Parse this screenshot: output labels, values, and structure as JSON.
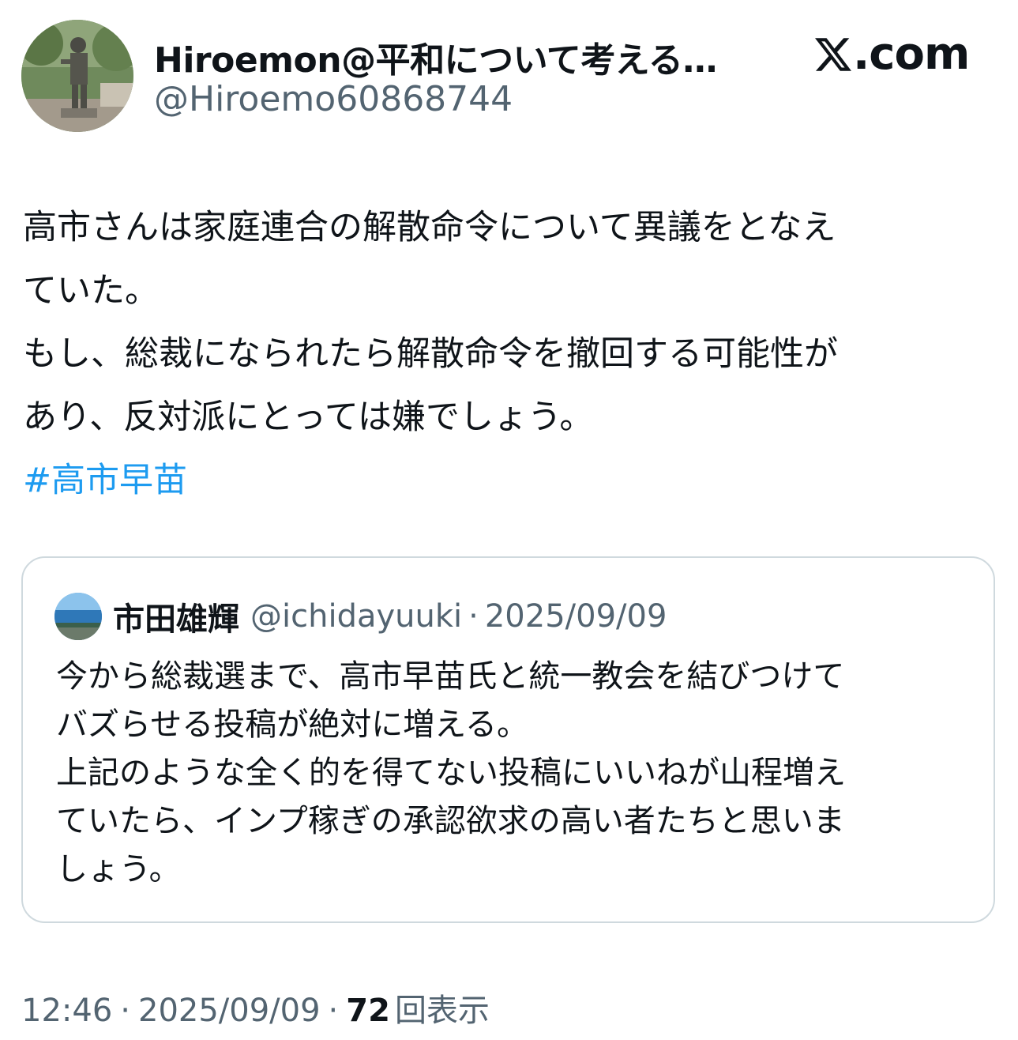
{
  "author": {
    "display_name": "Hiroemon@平和について考える…",
    "handle": "@Hiroemo60868744"
  },
  "brand": {
    "logo_suffix": ".com",
    "icon": "x-logo-icon"
  },
  "tweet": {
    "lines": [
      "高市さんは家庭連合の解散命令について異議をとなえ",
      "ていた。",
      "もし、総裁になられたら解散命令を撤回する可能性が",
      "あり、反対派にとっては嫌でしょう。"
    ],
    "hashtag": "#高市早苗"
  },
  "quote": {
    "name": "市田雄輝",
    "handle": "@ichidayuuki",
    "separator": "·",
    "date": "2025/09/09",
    "lines": [
      "今から総裁選まで、高市早苗氏と統一教会を結びつけて",
      "バズらせる投稿が絶対に増える。",
      "上記のような全く的を得てない投稿にいいねが山程増え",
      "ていたら、インプ稼ぎの承認欲求の高い者たちと思いま",
      "しょう。"
    ]
  },
  "meta": {
    "time": "12:46",
    "separator": "·",
    "date": "2025/09/09",
    "views_count": "72",
    "views_label": "回表示"
  },
  "colors": {
    "hashtag": "#1d9bf0",
    "secondary_text": "#536471",
    "primary_text": "#0f1419",
    "border": "#cfd9de"
  }
}
